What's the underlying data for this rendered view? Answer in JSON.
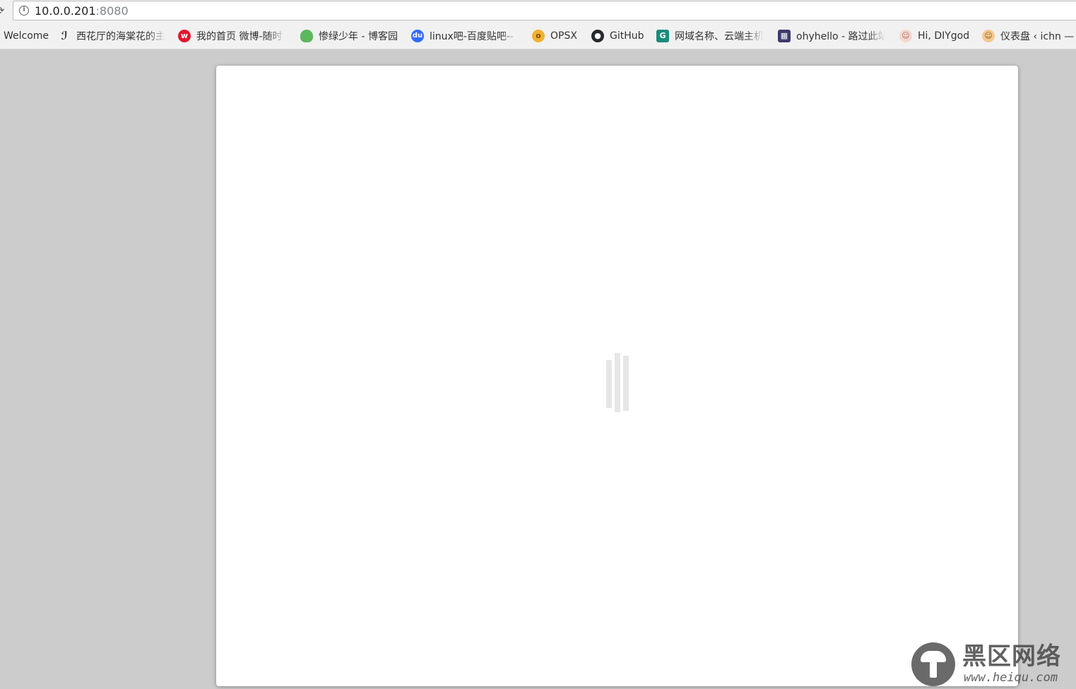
{
  "browser": {
    "url_host": "10.0.0.201",
    "url_port": ":8080"
  },
  "bookmarks": [
    {
      "label": "Welcome",
      "icon": "none"
    },
    {
      "label": "西花厅的海棠花的主",
      "icon": "hand-drawn-logo-icon"
    },
    {
      "label": "我的首页 微博-随时",
      "icon": "weibo-icon"
    },
    {
      "label": "惨绿少年 - 博客园",
      "icon": "frog-icon"
    },
    {
      "label": "linux吧-百度贴吧--",
      "icon": "baidu-paw-icon"
    },
    {
      "label": "OPSX",
      "icon": "opsx-icon"
    },
    {
      "label": "GitHub",
      "icon": "github-icon"
    },
    {
      "label": "网域名称、云端主机",
      "icon": "godaddy-icon"
    },
    {
      "label": "ohyhello - 路过此站",
      "icon": "pixel-avatar-icon"
    },
    {
      "label": "Hi, DIYgod",
      "icon": "anime-avatar-icon"
    },
    {
      "label": "仪表盘 ‹ ichn —",
      "icon": "anime-avatar-icon"
    }
  ],
  "colors": {
    "background": "#cccccc",
    "card": "#ffffff",
    "loader": "#e6e6e6",
    "weibo": "#e6162d",
    "baidu": "#2f6bff",
    "opsx": "#f2b230",
    "godaddy": "#1b8c7c"
  },
  "watermark": {
    "title": "黑区网络",
    "url": "www.heiqu.com"
  }
}
